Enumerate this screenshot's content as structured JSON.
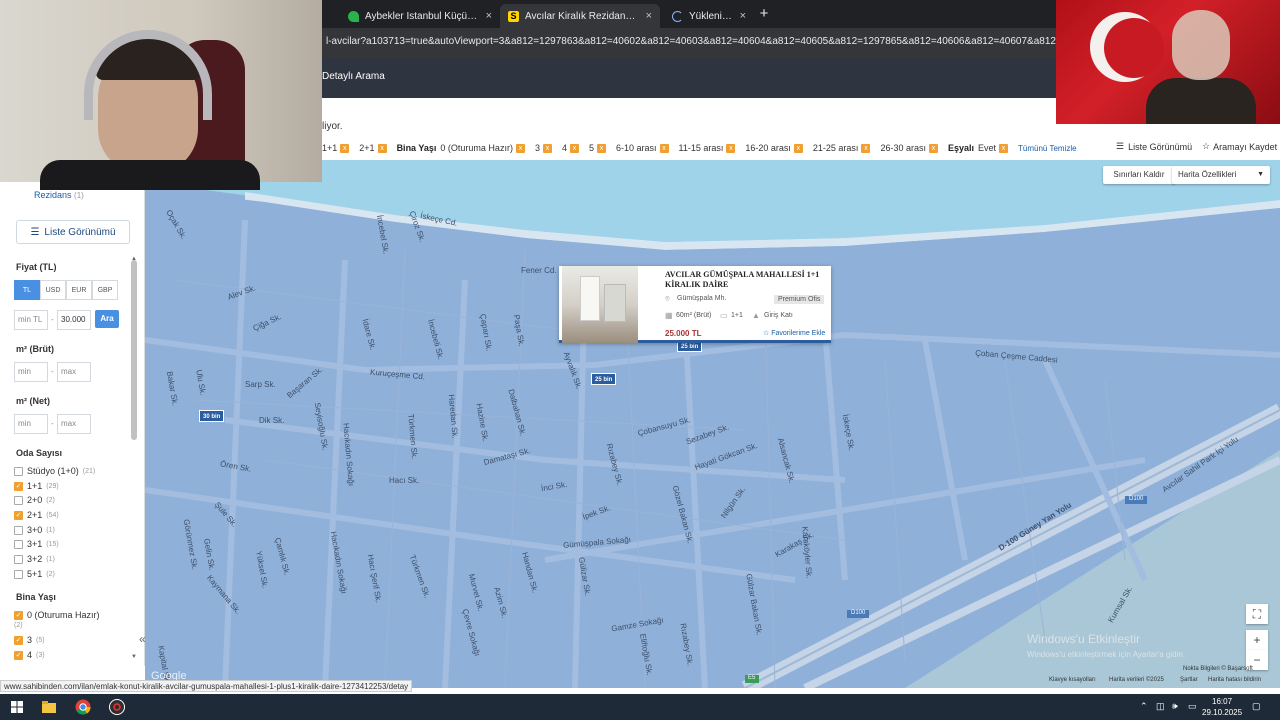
{
  "browser": {
    "tabs": [
      {
        "title": "Aybekler İstanbul Küçükçekmece",
        "fav_color": "#2bb24c",
        "active": false
      },
      {
        "title": "Avcılar Kiralık Rezidans, Villa, M",
        "fav_color": "#ffd400",
        "fav_letter": "S",
        "active": true
      },
      {
        "title": "Yükleniyor...",
        "fav_color": "#35363a",
        "active": false
      }
    ],
    "new_tab": "+",
    "close": "×",
    "url": "l-avcilar?a103713=true&autoViewport=3&a812=1297863&a812=40602&a812=40603&a812=40604&a812=40605&a812=1297865&a812=40606&a812=40607&a812=43901&a"
  },
  "header": {
    "detailed_search": "Detaylı Arama"
  },
  "notice": "liyor.",
  "chips": {
    "items": [
      "1+1",
      "2+1"
    ],
    "building_age_label": "Bina Yaşı",
    "building_ages": [
      "0 (Oturuma Hazır)",
      "3",
      "4",
      "5",
      "6-10 arası",
      "11-15 arası",
      "16-20 arası",
      "21-25 arası",
      "26-30 arası"
    ],
    "furnished_label": "Eşyalı",
    "furnished_value": "Evet",
    "clear_all": "Tümünü Temizle",
    "remove": "x"
  },
  "top_actions": {
    "list_view": "Liste Görünümü",
    "save_search": "Aramayı Kaydet"
  },
  "sidebar": {
    "rezidans": "Rezidans",
    "rezidans_count": "(1)",
    "list_view": "Liste Görünümü",
    "price_title": "Fiyat (TL)",
    "currencies": [
      "TL",
      "USD",
      "EUR",
      "GBP"
    ],
    "active_currency": "TL",
    "min_placeholder": "min TL",
    "max_value": "30.000",
    "search_btn": "Ara",
    "dash": "-",
    "m2_brut": "m² (Brüt)",
    "m2_net": "m² (Net)",
    "min": "min",
    "max": "max",
    "room_title": "Oda Sayısı",
    "rooms": [
      {
        "label": "Stüdyo (1+0)",
        "count": "(21)",
        "checked": false
      },
      {
        "label": "1+1",
        "count": "(29)",
        "checked": true
      },
      {
        "label": "2+0",
        "count": "(2)",
        "checked": false
      },
      {
        "label": "2+1",
        "count": "(54)",
        "checked": true
      },
      {
        "label": "3+0",
        "count": "(1)",
        "checked": false
      },
      {
        "label": "3+1",
        "count": "(15)",
        "checked": false
      },
      {
        "label": "3+2",
        "count": "(1)",
        "checked": false
      },
      {
        "label": "5+1",
        "count": "(2)",
        "checked": false
      }
    ],
    "age_title": "Bina Yaşı",
    "ages": [
      {
        "label": "0 (Oturuma Hazır)",
        "count": "(2)",
        "checked": true
      },
      {
        "label": "3",
        "count": "(5)",
        "checked": true
      },
      {
        "label": "4",
        "count": "(3)",
        "checked": true
      }
    ],
    "collapse": "«"
  },
  "map": {
    "boundary_btn": "Sınırları Kaldır",
    "features_btn": "Harita Özellikleri",
    "streets": [
      "İskeçe Cd.",
      "Oçak Sk.",
      "İncebel Sk.",
      "Çiroz Sk.",
      "Fener Cd.",
      "Alev Sk.",
      "Çiğa Sk.",
      "İdare Sk.",
      "İncebeli Sk.",
      "Çaparı Sk.",
      "Paşa Sk.",
      "Kuruçeşme Cd.",
      "Ayvalık Sk.",
      "Sarp Sk.",
      "Bakar Sk.",
      "Ulu Sk.",
      "Başaran Sk.",
      "Dik Sk.",
      "Seyisoğlu Sk.",
      "Hacıkadın Sokağı",
      "Türkmen Sk.",
      "Haredan Sk.",
      "Hazine Sk.",
      "Dalbahan Sk.",
      "Damataşı Sk.",
      "Çobansuyu Sk.",
      "Sezabey Sk.",
      "Hayati Gökcan Sk.",
      "Alsancak Sk.",
      "Çoban Çeşme Caddesi",
      "İskeçe Sk.",
      "Ören Sk.",
      "Hacı Sk.",
      "İnci Sk.",
      "Rızabey Sk.",
      "Nilgün Sk.",
      "Karakaş Sk.",
      "İpek Sk.",
      "Gözel Bakan Sk.",
      "Gümüşpala Sokağı",
      "Şule Sk.",
      "Görünmez Sk.",
      "Gelin Sk.",
      "Kaymana Sk.",
      "Yüksel Sk.",
      "Çamlık Sk.",
      "Hacıkadın Sokağı",
      "Hacı Şerif Sk.",
      "Türkmen Sk.",
      "Handan Sk.",
      "Murvet Sk.",
      "Azim Sk.",
      "Gülizar Sk.",
      "Gamze Sokağı",
      "Gülzar Bakan Sk.",
      "Karaköyler Sk.",
      "D-100 Güney Yan Yolu",
      "Avcılar Sahil Park İçi Yolu",
      "Kumsal Sk.",
      "Çevre Sokağı",
      "Eliftoğlu Sk.",
      "Rızabey Sk.",
      "Kapital Sk."
    ],
    "pins": [
      "30 bin",
      "25 bin",
      "25 bin"
    ],
    "zoom_in": "+",
    "zoom_out": "−",
    "fullscreen": "⛶",
    "footer": [
      "Klavye kısayolları",
      "Harita verileri ©2025",
      "Şartlar",
      "Harita hatası bildirin"
    ],
    "attribution": "Nokta Bilgileri © Başarsoft",
    "google": "Google",
    "watermark_title": "Windows'u Etkinleştir",
    "watermark_sub": "Windows'u etkinleştirmek için Ayarlar'a gidin.",
    "road_labels": [
      "D100",
      "D100",
      "E5",
      "E5"
    ]
  },
  "card": {
    "title": "AVCILAR GÜMÜŞPALA MAHALLESİ 1+1 KİRALIK DAİRE",
    "location": "Gümüşpala Mh.",
    "badge": "Premium Ofis",
    "area": "60m² (Brüt)",
    "rooms": "1+1",
    "floor": "Giriş Katı",
    "price": "25.000 TL",
    "favorite": "Favorilerime Ekle"
  },
  "status_url": "www.sahibinden.com/ilan/emlak-konut-kiralik-avcilar-gumuspala-mahallesi-1-plus1-kiralik-daire-1273412253/detay",
  "taskbar": {
    "time": "16:07",
    "date": "29.10.2025"
  }
}
